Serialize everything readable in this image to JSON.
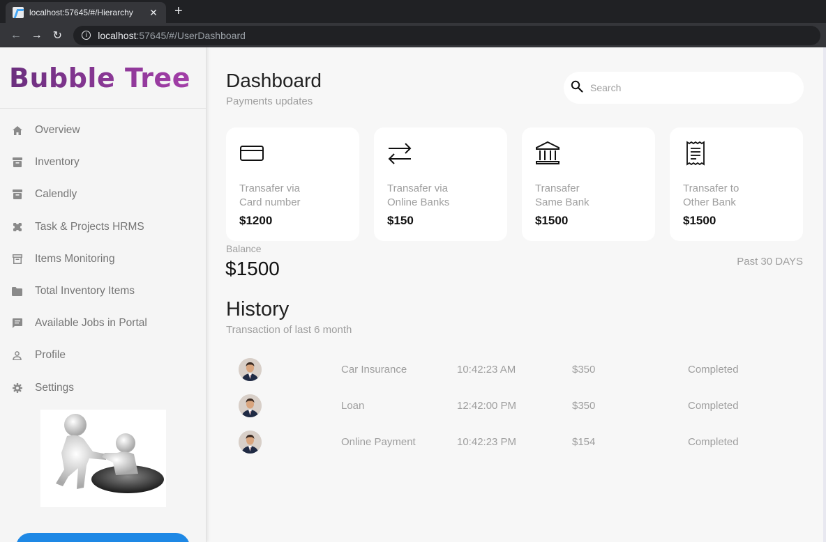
{
  "browser": {
    "tab_title": "localhost:57645/#/Hierarchy",
    "url_host": "localhost",
    "url_rest": ":57645/#/UserDashboard"
  },
  "sidebar": {
    "brand": "Bubble Tree",
    "items": [
      {
        "label": "Overview",
        "icon": "home-icon"
      },
      {
        "label": "Inventory",
        "icon": "archive-icon"
      },
      {
        "label": "Calendly",
        "icon": "archive-icon"
      },
      {
        "label": "Task & Projects HRMS",
        "icon": "puzzle-icon"
      },
      {
        "label": "Items Monitoring",
        "icon": "archive-outline-icon"
      },
      {
        "label": "Total Inventory Items",
        "icon": "folder-icon"
      },
      {
        "label": "Available Jobs in Portal",
        "icon": "chat-icon"
      },
      {
        "label": "Profile",
        "icon": "person-icon"
      },
      {
        "label": "Settings",
        "icon": "gear-icon"
      }
    ]
  },
  "header": {
    "title": "Dashboard",
    "subtitle": "Payments updates",
    "search_placeholder": "Search"
  },
  "cards": [
    {
      "label": "Transafer via\nCard number",
      "amount": "$1200",
      "icon": "credit-card-icon"
    },
    {
      "label": "Transafer via\nOnline Banks",
      "amount": "$150",
      "icon": "transfer-arrows-icon"
    },
    {
      "label": "Transafer\nSame Bank",
      "amount": "$1500",
      "icon": "bank-icon"
    },
    {
      "label": "Transafer to\nOther Bank",
      "amount": "$1500",
      "icon": "receipt-icon"
    }
  ],
  "balance": {
    "label": "Balance",
    "value": "$1500",
    "period": "Past 30 DAYS"
  },
  "history": {
    "title": "History",
    "subtitle": "Transaction of last 6 month",
    "rows": [
      {
        "name": "Car Insurance",
        "time": "10:42:23 AM",
        "amount": "$350",
        "status": "Completed"
      },
      {
        "name": "Loan",
        "time": "12:42:00 PM",
        "amount": "$350",
        "status": "Completed"
      },
      {
        "name": "Online Payment",
        "time": "10:42:23 PM",
        "amount": "$154",
        "status": "Completed"
      }
    ]
  }
}
